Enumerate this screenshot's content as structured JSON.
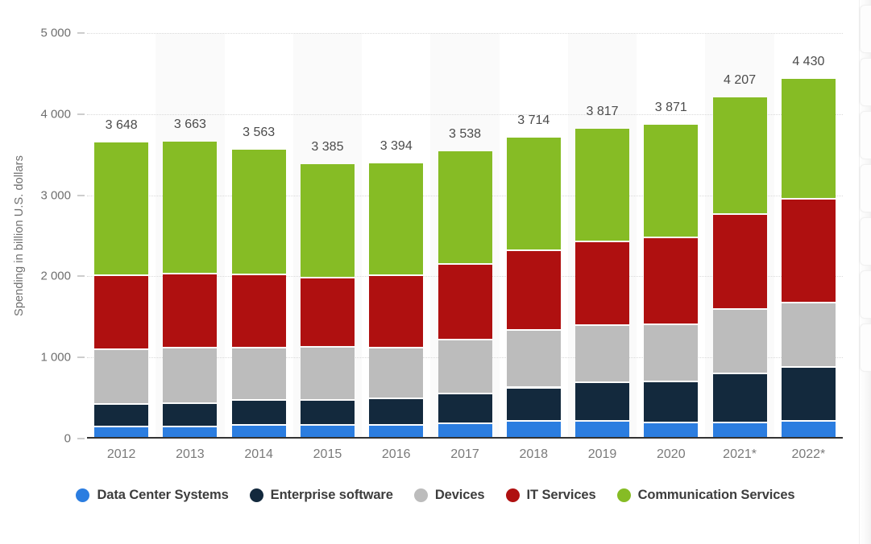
{
  "chart_data": {
    "type": "bar",
    "stacked": true,
    "title": "",
    "subtitle": "",
    "xlabel": "",
    "ylabel": "Spending in billion U.S. dollars",
    "ylim": [
      0,
      5000
    ],
    "yticks": [
      0,
      1000,
      2000,
      3000,
      4000,
      5000
    ],
    "ytick_labels": [
      "0",
      "1 000",
      "2 000",
      "3 000",
      "4 000",
      "5 000"
    ],
    "grid": true,
    "legend_position": "bottom",
    "categories": [
      "2012",
      "2013",
      "2014",
      "2015",
      "2016",
      "2017",
      "2018",
      "2019",
      "2020",
      "2021*",
      "2022*"
    ],
    "series": [
      {
        "name": "Data Center Systems",
        "color": "#2b7de0",
        "values": [
          143,
          140,
          157,
          160,
          158,
          181,
          210,
          205,
          188,
          192,
          207
        ]
      },
      {
        "name": "Enterprise software",
        "color": "#13293d",
        "values": [
          278,
          285,
          310,
          310,
          326,
          369,
          410,
          477,
          503,
          599,
          670
        ]
      },
      {
        "name": "Devices",
        "color": "#bcbcbc",
        "values": [
          666,
          684,
          640,
          655,
          629,
          663,
          706,
          711,
          705,
          793,
          793
        ]
      },
      {
        "name": "IT Services",
        "color": "#af1010",
        "values": [
          913,
          918,
          904,
          854,
          894,
          933,
          990,
          1031,
          1071,
          1175,
          1279
        ]
      },
      {
        "name": "Communication Services",
        "color": "#86bc25",
        "values": [
          1648,
          1636,
          1552,
          1406,
          1387,
          1392,
          1398,
          1393,
          1404,
          1448,
          1481
        ]
      }
    ],
    "totals": [
      3648,
      3663,
      3563,
      3385,
      3394,
      3538,
      3714,
      3817,
      3871,
      4207,
      4430
    ],
    "total_labels": [
      "3 648",
      "3 663",
      "3 563",
      "3 385",
      "3 394",
      "3 538",
      "3 714",
      "3 817",
      "3 871",
      "4 207",
      "4 430"
    ],
    "footnote_marker": "*"
  },
  "colors": {
    "background": "#ffffff",
    "band": "#fafafa",
    "gridline": "#d9d9d9",
    "axis": "#333333",
    "axis_text": "#6f6f6f",
    "label_text": "#4b4b4b",
    "legend_text": "#3d3d3d"
  }
}
